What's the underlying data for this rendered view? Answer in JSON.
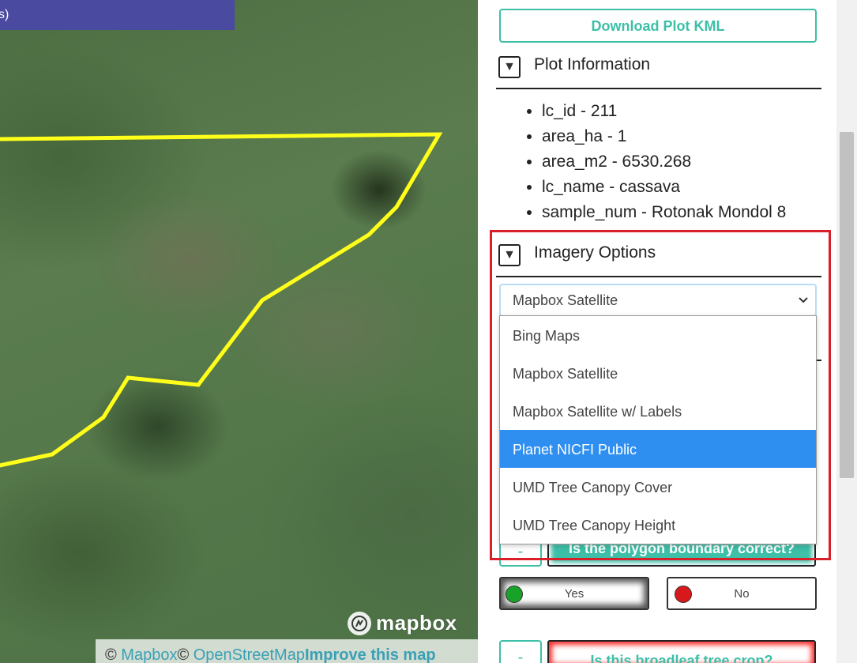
{
  "map": {
    "top_bar_text": "s)",
    "logo_text": "mapbox",
    "attribution": {
      "prefix": "© ",
      "mapbox_link": "Mapbox",
      "mid": "© ",
      "osm_link": "OpenStreetMap",
      "improve_link": "Improve this map"
    },
    "polygon_color": "#ffff1a"
  },
  "sidebar": {
    "download_button": "Download Plot KML",
    "plot_info": {
      "title": "Plot Information",
      "items": [
        "lc_id - 211",
        "area_ha - 1",
        "area_m2 - 6530.268",
        "lc_name - cassava",
        "sample_num - Rotonak Mondol 8"
      ]
    },
    "imagery": {
      "title": "Imagery Options",
      "selected_value": "Mapbox Satellite",
      "options": [
        "Bing Maps",
        "Mapbox Satellite",
        "Mapbox Satellite w/ Labels",
        "Planet NICFI Public",
        "UMD Tree Canopy Cover",
        "UMD Tree Canopy Height"
      ],
      "highlighted_option": "Planet NICFI Public"
    },
    "question1": {
      "collapse_label": "-",
      "text": "Is the polygon boundary correct?",
      "answers": [
        "Yes",
        "No"
      ]
    },
    "question2": {
      "collapse_label": "-",
      "text": "Is this broadleaf tree crop?"
    },
    "toggle_icon": "▼"
  },
  "colors": {
    "accent": "#3dbfa8",
    "highlight": "#d9202a",
    "selected_option": "#2f8ff0",
    "yes_dot": "#18a22a",
    "no_dot": "#d7191c"
  }
}
